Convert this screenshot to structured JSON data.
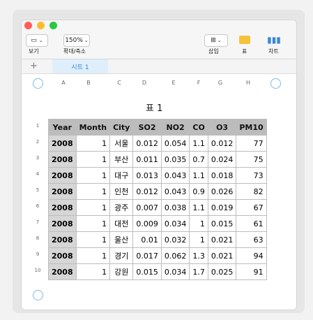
{
  "toolbar": {
    "view_label": "보기",
    "zoom_value": "150%",
    "zoom_label": "확대/축소",
    "insert_label": "삽입",
    "table_label": "표",
    "chart_label": "차트"
  },
  "tabs": [
    {
      "label": "시트 1"
    }
  ],
  "columns": [
    "A",
    "B",
    "C",
    "D",
    "E",
    "F",
    "G",
    "H"
  ],
  "table_title": "표 1",
  "table": {
    "headers": [
      "Year",
      "Month",
      "City",
      "SO2",
      "NO2",
      "CO",
      "O3",
      "PM10"
    ],
    "rows": [
      [
        "2008",
        "1",
        "서울",
        "0.012",
        "0.054",
        "1.1",
        "0.012",
        "77"
      ],
      [
        "2008",
        "1",
        "부산",
        "0.011",
        "0.035",
        "0.7",
        "0.024",
        "75"
      ],
      [
        "2008",
        "1",
        "대구",
        "0.013",
        "0.043",
        "1.1",
        "0.018",
        "73"
      ],
      [
        "2008",
        "1",
        "인천",
        "0.012",
        "0.043",
        "0.9",
        "0.026",
        "82"
      ],
      [
        "2008",
        "1",
        "광주",
        "0.007",
        "0.038",
        "1.1",
        "0.019",
        "67"
      ],
      [
        "2008",
        "1",
        "대전",
        "0.009",
        "0.034",
        "1",
        "0.015",
        "61"
      ],
      [
        "2008",
        "1",
        "울산",
        "0.01",
        "0.032",
        "1",
        "0.021",
        "63"
      ],
      [
        "2008",
        "1",
        "경기",
        "0.017",
        "0.062",
        "1.3",
        "0.021",
        "94"
      ],
      [
        "2008",
        "1",
        "강원",
        "0.015",
        "0.034",
        "1.7",
        "0.025",
        "91"
      ]
    ]
  },
  "row_numbers": [
    "1",
    "2",
    "3",
    "4",
    "5",
    "6",
    "7",
    "8",
    "9",
    "10"
  ],
  "colors": {
    "accent": "#3a87d6",
    "close": "#ff5f57",
    "minimize": "#febc2e",
    "maximize": "#28c840"
  }
}
